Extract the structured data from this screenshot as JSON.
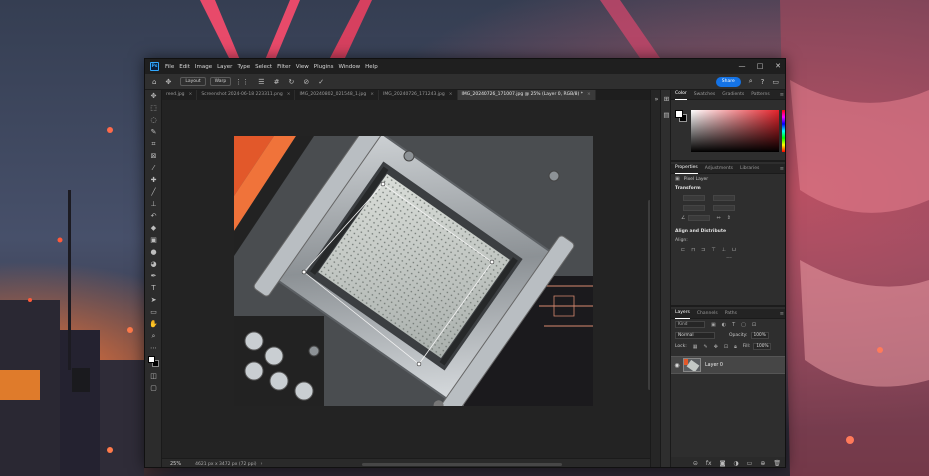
{
  "window": {
    "menu": [
      "File",
      "Edit",
      "Image",
      "Layer",
      "Type",
      "Select",
      "Filter",
      "View",
      "Plugins",
      "Window",
      "Help"
    ],
    "controls": [
      "—",
      "□",
      "✕"
    ]
  },
  "options_bar": {
    "layout_label": "Layout",
    "warp_label": "Warp",
    "share_label": "Share"
  },
  "tabs": [
    {
      "label": "reed.jpg"
    },
    {
      "label": "Screenshot 2024-06-18 223311.png"
    },
    {
      "label": "IMG_20240802_021548_1.jpg"
    },
    {
      "label": "IMG_20240726_171243.jpg"
    },
    {
      "label": "IMG_20240726_171007.jpg @ 25% (Layer 0, RGB/8) *"
    }
  ],
  "status": {
    "zoom": "25%",
    "doc_info": "4621 px x 3472 px (72 ppi)"
  },
  "color_panel": {
    "tabs": [
      "Color",
      "Swatches",
      "Gradients",
      "Patterns"
    ],
    "active_tab": "Color"
  },
  "properties_panel": {
    "tabs": [
      "Properties",
      "Adjustments",
      "Libraries"
    ],
    "layer_type": "Pixel Layer",
    "transform_title": "Transform",
    "align_title": "Align and Distribute",
    "align_label": "Align:"
  },
  "layers_panel": {
    "tabs": [
      "Layers",
      "Channels",
      "Paths"
    ],
    "kind_label": "Kind",
    "blend_mode": "Normal",
    "opacity_label": "Opacity:",
    "opacity_value": "100%",
    "lock_label": "Lock:",
    "fill_label": "Fill:",
    "fill_value": "100%",
    "layers": [
      {
        "name": "Layer 0",
        "visible": true
      }
    ]
  },
  "colors": {
    "accent": "#1473e6",
    "panel_bg": "#2e2e2e",
    "canvas_bg": "#232323"
  }
}
